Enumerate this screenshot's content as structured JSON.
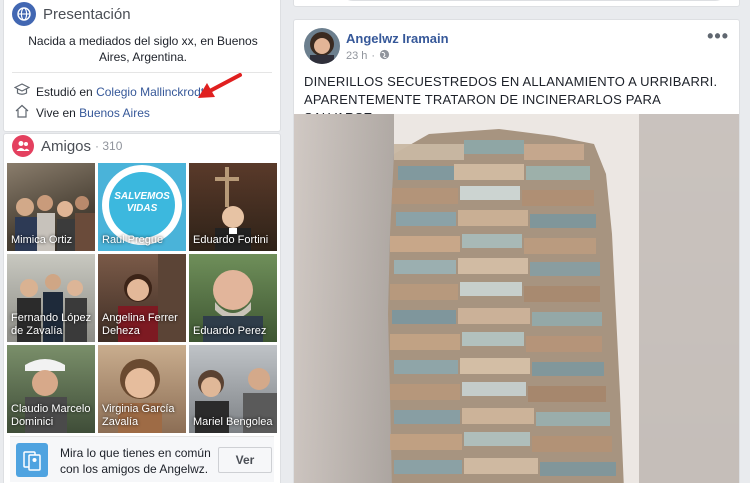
{
  "intro": {
    "title": "Presentación",
    "bio": "Nacida a mediados del siglo xx, en Buenos Aires, Argentina.",
    "studied_prefix": "Estudió en",
    "studied_place": "Colegio Mallinckrodt",
    "lives_prefix": "Vive en",
    "lives_place": "Buenos Aires"
  },
  "friends": {
    "title": "Amigos",
    "count": "· 310",
    "list": [
      {
        "name": "Mimica Ortiz"
      },
      {
        "name": "Raul Pregue"
      },
      {
        "name": "Eduardo Fortini"
      },
      {
        "name": "Fernando López de Zavalía"
      },
      {
        "name": "Angelina Ferrer Deheza"
      },
      {
        "name": "Eduardo Perez"
      },
      {
        "name": "Claudio Marcelo Dominici"
      },
      {
        "name": "Virginia García Zavalía"
      },
      {
        "name": "Mariel Bengolea"
      }
    ],
    "common_text": "Mira lo que tienes en común con los amigos de Angelwz.",
    "common_button": "Ver",
    "tile_text_raul": "SALVEMOS VIDAS"
  },
  "post": {
    "author": "Angelwz Iramain",
    "time": "23 h",
    "text": "DINERILLOS SECUESTREDOS EN ALLANAMIENTO A URRIBARRI. APARENTEMENTE TRATARON DE INCINERARLOS PARA SALVARSE...",
    "more_icon": "more-icon"
  },
  "colors": {
    "link": "#365899",
    "accent": "#4267b2",
    "annotation_arrow": "#e02020"
  }
}
